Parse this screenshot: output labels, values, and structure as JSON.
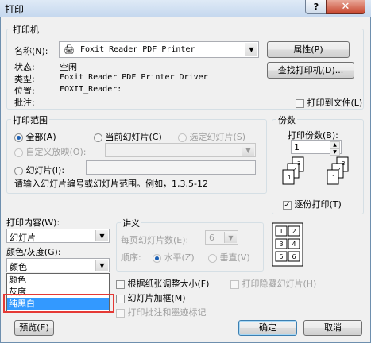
{
  "window": {
    "title": "打印",
    "help": "?",
    "close": "✕"
  },
  "printer": {
    "group": "打印机",
    "name_label": "名称(N):",
    "name_value": "Foxit Reader PDF Printer",
    "properties_btn": "属性(P)",
    "find_btn": "查找打印机(D)...",
    "status_label": "状态:",
    "status_value": "空闲",
    "type_label": "类型:",
    "type_value": "Foxit Reader PDF Printer Driver",
    "location_label": "位置:",
    "location_value": "FOXIT_Reader:",
    "comment_label": "批注:",
    "print_to_file": "打印到文件(L)"
  },
  "range": {
    "group": "打印范围",
    "all": "全部(A)",
    "current": "当前幻灯片(C)",
    "selection": "选定幻灯片(S)",
    "custom_show": "自定义放映(O):",
    "slides": "幻灯片(I):",
    "hint": "请输入幻灯片编号或幻灯片范围。例如，1,3,5-12"
  },
  "copies": {
    "group": "份数",
    "count_label": "打印份数(B):",
    "count_value": "1",
    "collate": "逐份打印(T)",
    "page_labels": [
      "1",
      "2",
      "3",
      "1",
      "2",
      "3"
    ]
  },
  "content": {
    "print_what_label": "打印内容(W):",
    "print_what_value": "幻灯片",
    "color_label": "颜色/灰度(G):",
    "color_value": "颜色",
    "options": [
      "颜色",
      "灰度",
      "纯黑白"
    ],
    "selected_index": 2
  },
  "handouts": {
    "group": "讲义",
    "per_page_label": "每页幻灯片数(E):",
    "per_page_value": "6",
    "order_label": "顺序:",
    "horizontal": "水平(Z)",
    "vertical": "垂直(V)",
    "thumb_labels": [
      "1",
      "2",
      "3",
      "4",
      "5",
      "6"
    ]
  },
  "options": {
    "scale": "根据纸张调整大小(F)",
    "hidden": "打印隐藏幻灯片(H)",
    "frame": "幻灯片加框(M)",
    "comments": "打印批注和墨迹标记"
  },
  "footer": {
    "preview": "预览(E)",
    "ok": "确定",
    "cancel": "取消"
  },
  "colors": {
    "highlight": "#3399ff",
    "annotation_box": "#e53935",
    "ok_border": "#3c7fb1"
  }
}
